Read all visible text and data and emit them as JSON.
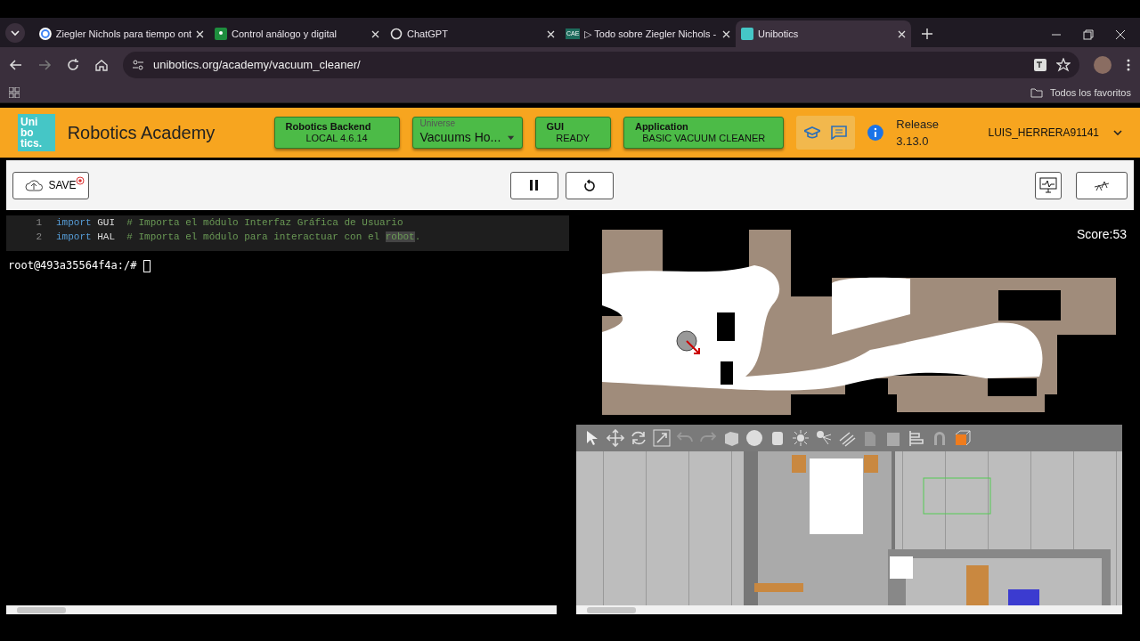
{
  "browser": {
    "tabs": [
      {
        "title": "Ziegler Nichols para tiempo ont",
        "selected": false
      },
      {
        "title": "Control análogo y digital",
        "selected": false
      },
      {
        "title": "ChatGPT",
        "selected": false
      },
      {
        "title": "▷ Todo sobre Ziegler Nichols -",
        "icon_text": "CAE",
        "selected": false
      },
      {
        "title": "Unibotics",
        "selected": true
      }
    ],
    "address": "unibotics.org/academy/vacuum_cleaner/",
    "bookmarks": "Todos los favoritos"
  },
  "header": {
    "logo": [
      "Uni",
      "bo",
      "tics."
    ],
    "title": "Robotics Academy",
    "status": [
      {
        "kind": "box",
        "label": "Robotics Backend",
        "value": "LOCAL 4.6.14"
      },
      {
        "kind": "select",
        "label": "Universe",
        "value": "Vacuums Ho..."
      },
      {
        "kind": "box",
        "label": "GUI",
        "value": "READY"
      },
      {
        "kind": "box",
        "label": "Application",
        "value": "BASIC VACUUM CLEANER"
      }
    ],
    "release": [
      "Release",
      "3.13.0"
    ],
    "user": "LUIS_HERRERA91141"
  },
  "toolbar": {
    "save": "SAVE"
  },
  "editor": {
    "lines": [
      {
        "number": "1",
        "keyword": "import",
        "module": "GUI",
        "comment": "# Importa el módulo Interfaz Gráfica de Usuario"
      },
      {
        "number": "2",
        "keyword": "import",
        "module": "HAL",
        "comment": "# Importa el módulo para interactuar con el ",
        "highlight": "robot",
        "after": "."
      }
    ]
  },
  "terminal": {
    "prompt": "root@493a35564f4a:/#"
  },
  "map": {
    "score": "Score:53"
  }
}
